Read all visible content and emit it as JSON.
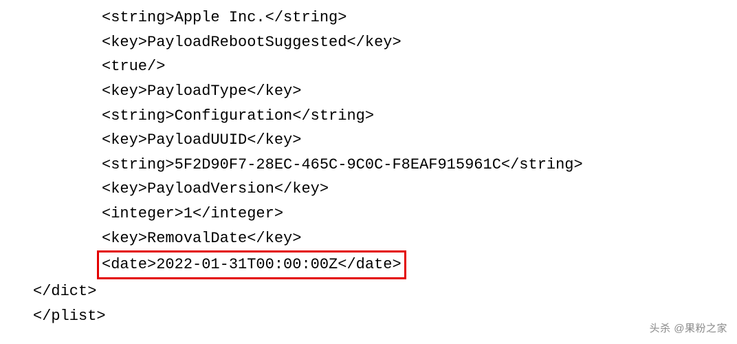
{
  "lines": {
    "l1": "<string>Apple Inc.</string>",
    "l2": "<key>PayloadRebootSuggested</key>",
    "l3": "<true/>",
    "l4": "<key>PayloadType</key>",
    "l5": "<string>Configuration</string>",
    "l6": "<key>PayloadUUID</key>",
    "l7": "<string>5F2D90F7-28EC-465C-9C0C-F8EAF915961C</string>",
    "l8": "<key>PayloadVersion</key>",
    "l9": "<integer>1</integer>",
    "l10": "<key>RemovalDate</key>",
    "l11": "<date>2022-01-31T00:00:00Z</date>",
    "l12": "</dict>",
    "l13": "</plist>"
  },
  "watermark": "头杀 @果粉之家"
}
